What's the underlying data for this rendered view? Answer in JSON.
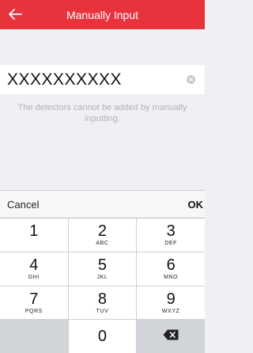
{
  "header": {
    "title": "Manually Input",
    "back_icon": "arrow-left-icon"
  },
  "input": {
    "value": "XXXXXXXXXX",
    "clear_icon": "clear-icon"
  },
  "hint": "The detectors cannot be added by manually inputting.",
  "keyboard_bar": {
    "cancel_label": "Cancel",
    "ok_label": "OK"
  },
  "keypad": {
    "keys": [
      {
        "num": "1",
        "letters": ""
      },
      {
        "num": "2",
        "letters": "ABC"
      },
      {
        "num": "3",
        "letters": "DEF"
      },
      {
        "num": "4",
        "letters": "GHI"
      },
      {
        "num": "5",
        "letters": "JKL"
      },
      {
        "num": "6",
        "letters": "MNO"
      },
      {
        "num": "7",
        "letters": "PQRS"
      },
      {
        "num": "8",
        "letters": "TUV"
      },
      {
        "num": "9",
        "letters": "WXYZ"
      }
    ],
    "zero": "0",
    "delete_icon": "backspace-icon"
  },
  "colors": {
    "header_bg": "#e8323c",
    "header_text": "#ffffff",
    "hint_text": "#b2b2b7"
  }
}
